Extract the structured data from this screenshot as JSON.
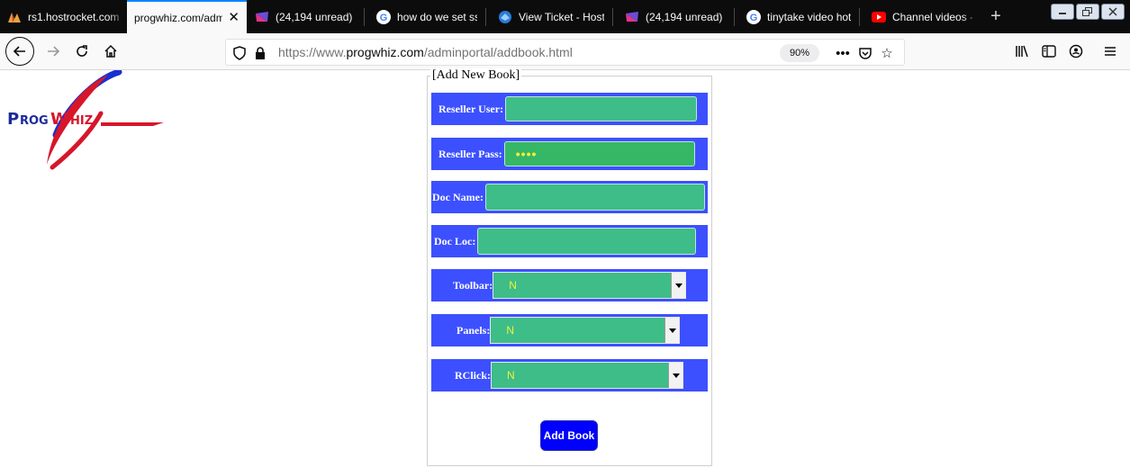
{
  "tabs": [
    {
      "title": "rs1.hostrocket.com",
      "favicon": "hostrocket-icon"
    },
    {
      "title": "progwhiz.com/adminportal",
      "favicon": "none",
      "active": true
    },
    {
      "title": "(24,194 unread) - ",
      "favicon": "mail-icon"
    },
    {
      "title": "how do we set ssl",
      "favicon": "google-icon"
    },
    {
      "title": "View Ticket - Host",
      "favicon": "ticket-icon"
    },
    {
      "title": "(24,194 unread) - ",
      "favicon": "mail-icon"
    },
    {
      "title": "tinytake video hot",
      "favicon": "google-icon"
    },
    {
      "title": "Channel videos - ",
      "favicon": "youtube-icon"
    }
  ],
  "navbar": {
    "url_prefix": "https://www.",
    "url_domain": "progwhiz.com",
    "url_path": "/adminportal/addbook.html",
    "zoom": "90%"
  },
  "logo": {
    "text": "ProgWhiz"
  },
  "form": {
    "legend": "[Add New Book]",
    "reseller_user_label": "Reseller User:",
    "reseller_pass_label": "Reseller Pass:",
    "reseller_pass_value": "••••",
    "doc_name_label": "Doc Name:",
    "doc_loc_label": "Doc Loc:",
    "toolbar_label": "Toolbar:",
    "toolbar_value": "N",
    "panels_label": "Panels:",
    "panels_value": "N",
    "rclick_label": "RClick:",
    "rclick_value": "N",
    "submit_label": "Add Book"
  },
  "colors": {
    "row_bg": "#3c50ff",
    "field_bg": "#3ebd88",
    "button_bg": "#0000ff",
    "select_text": "#f0f03c"
  }
}
